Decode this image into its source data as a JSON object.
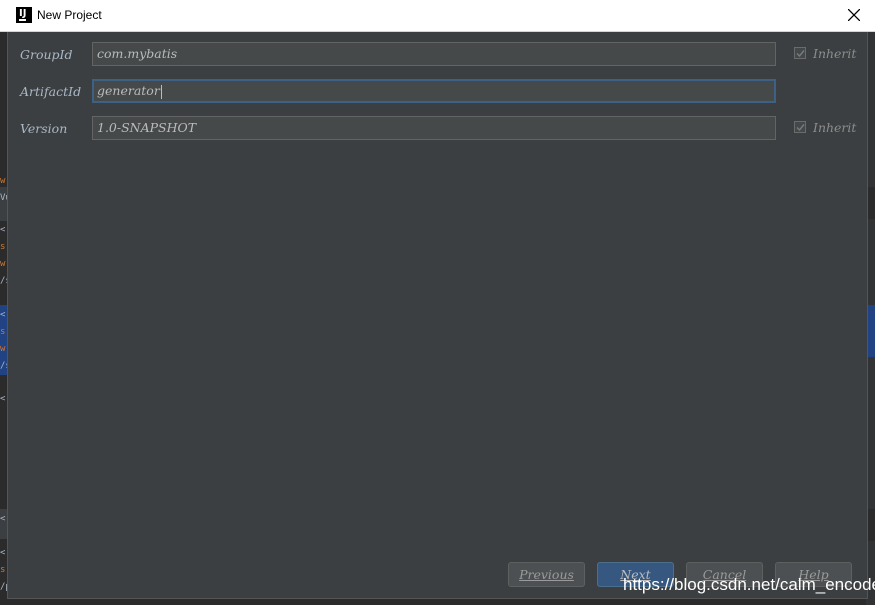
{
  "window": {
    "title": "New Project",
    "app_icon_letter": "IJ"
  },
  "form": {
    "group_id": {
      "label": "GroupId",
      "value": "com.mybatis",
      "inherit_label": "Inherit",
      "inherit_checked": true
    },
    "artifact_id": {
      "label": "ArtifactId",
      "value": "generator"
    },
    "version": {
      "label": "Version",
      "value": "1.0-SNAPSHOT",
      "inherit_label": "Inherit",
      "inherit_checked": true
    }
  },
  "buttons": {
    "previous": "Previous",
    "next": "Next",
    "cancel": "Cancel",
    "help": "Help"
  },
  "watermark": "https://blog.csdn.net/calm_encode",
  "colors": {
    "dialog_bg": "#3c3f41",
    "field_bg": "#45494a",
    "focus_border": "#3d6185",
    "primary_button": "#365880"
  }
}
